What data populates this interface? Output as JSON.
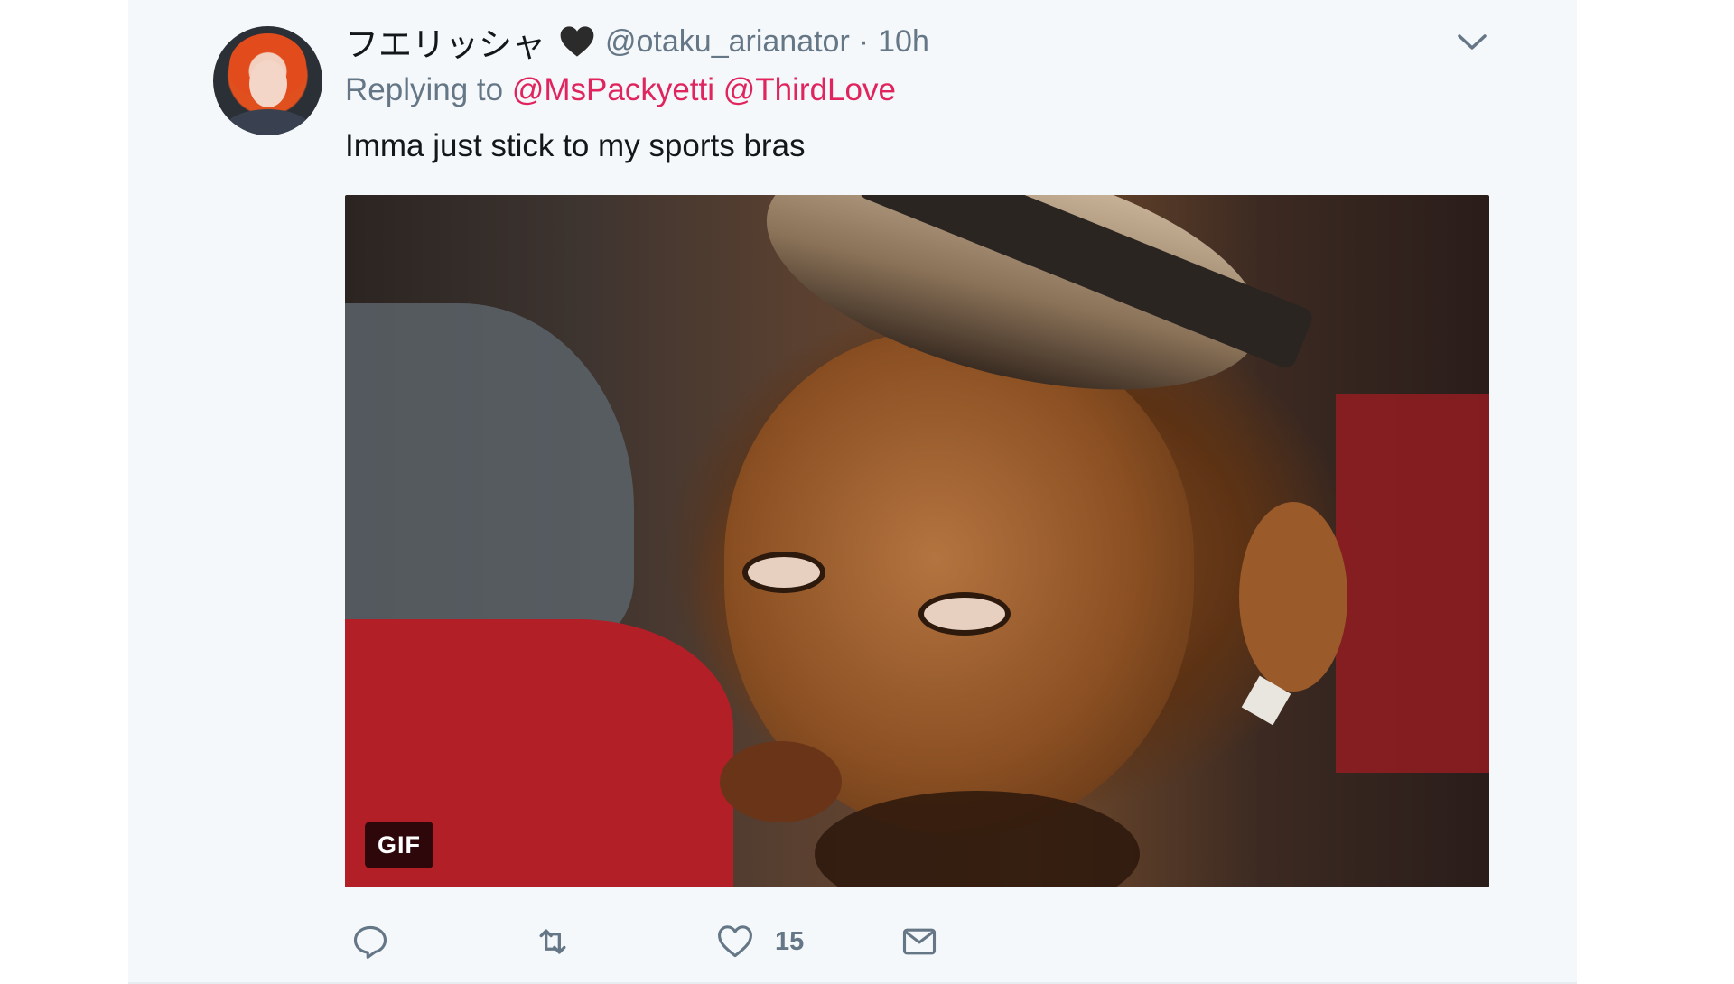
{
  "tweet": {
    "author": {
      "display_name": "フエリッシャ",
      "handle": "@otaku_arianator",
      "separator": "·",
      "time": "10h",
      "avatar_icon": "profile-photo"
    },
    "reply": {
      "prefix": "Replying to",
      "mentions": [
        "@MsPackyetti",
        "@ThirdLove"
      ]
    },
    "text": "Imma just stick to my sports bras",
    "media": {
      "type": "gif",
      "badge": "GIF"
    },
    "actions": {
      "reply_icon": "reply-icon",
      "retweet_icon": "retweet-icon",
      "like_icon": "heart-outline-icon",
      "like_count": "15",
      "message_icon": "envelope-icon"
    }
  },
  "colors": {
    "card_bg": "#f5f8fa",
    "mention": "#e0245e",
    "muted": "#657786",
    "text": "#14171a"
  }
}
